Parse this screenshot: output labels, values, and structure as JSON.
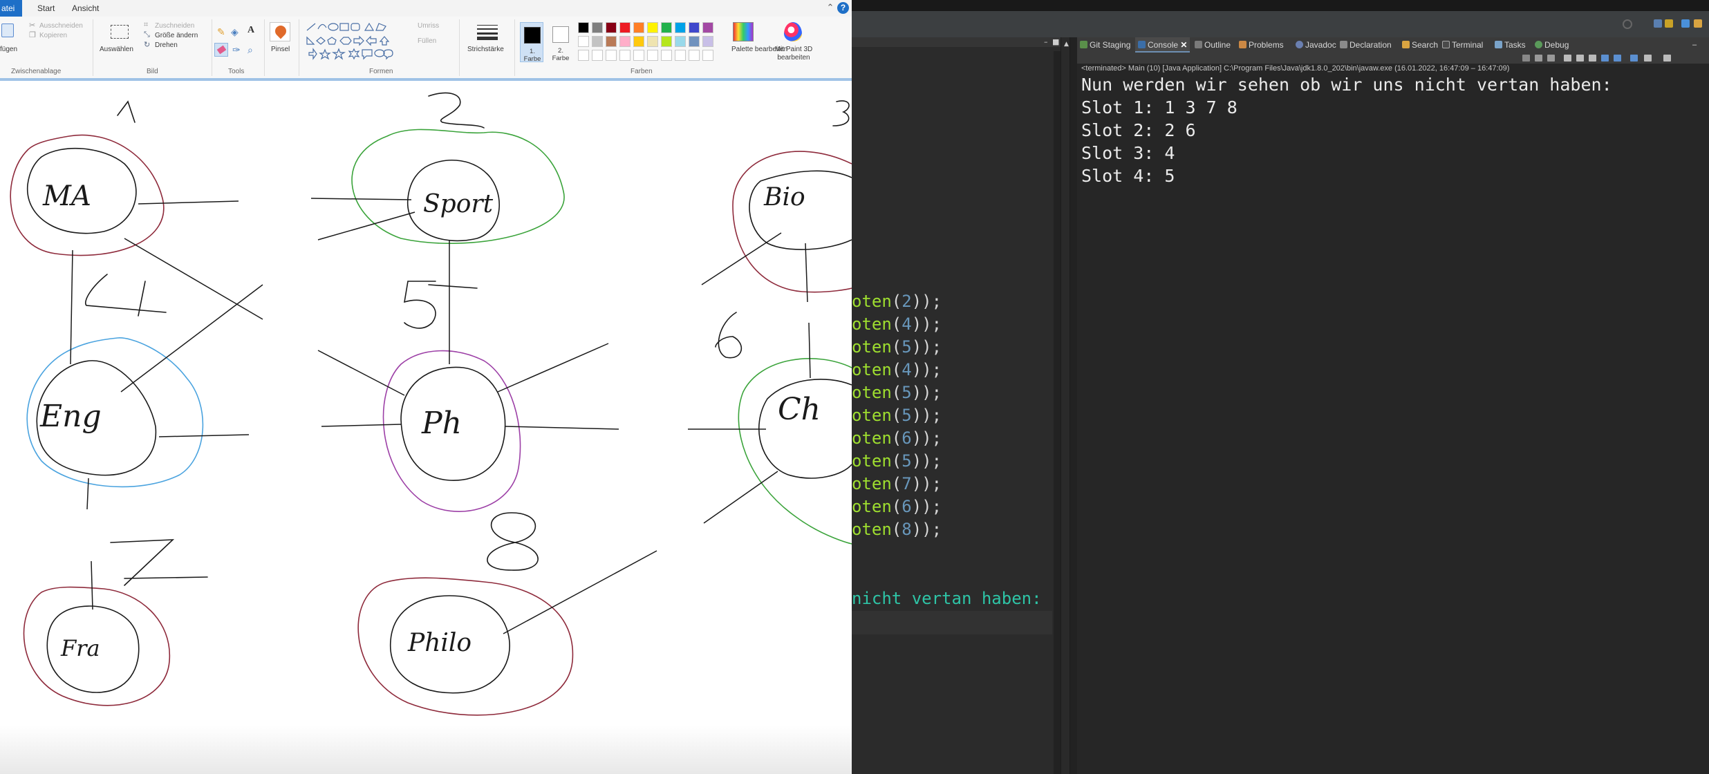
{
  "paint": {
    "tabs": [
      "atei",
      "Start",
      "Ansicht"
    ],
    "ribbon": {
      "clipboard": {
        "paste": "fügen",
        "cut": "Ausschneiden",
        "copy": "Kopieren",
        "group": "Zwischenablage"
      },
      "image": {
        "select": "Auswählen",
        "crop": "Zuschneiden",
        "resize": "Größe ändern",
        "rotate": "Drehen",
        "group": "Bild"
      },
      "tools": {
        "group": "Tools"
      },
      "brushes": {
        "label": "Pinsel"
      },
      "shapes": {
        "outline": "Umriss",
        "fill": "Füllen",
        "group": "Formen"
      },
      "size": {
        "label": "Strichstärke"
      },
      "colors": {
        "color1": "1. Farbe",
        "color2": "2. Farbe",
        "edit_palette": "Palette bearbeiten",
        "paint3d": "Mit Paint 3D bearbeiten",
        "group": "Farben",
        "palette_row1": [
          "#000000",
          "#7f7f7f",
          "#880015",
          "#ed1c24",
          "#ff7f27",
          "#fff200",
          "#22b14c",
          "#00a2e8",
          "#3f48cc",
          "#a349a4"
        ],
        "palette_row2": [
          "#ffffff",
          "#c3c3c3",
          "#b97a57",
          "#ffaec9",
          "#ffc90e",
          "#efe4b0",
          "#b5e61d",
          "#99d9ea",
          "#7092be",
          "#c8bfe7"
        ]
      }
    },
    "drawing": {
      "nodes": [
        "MA",
        "Sport",
        "Bio",
        "Eng",
        "Ph",
        "Ch",
        "Fra",
        "Philo"
      ],
      "numbers": [
        "1",
        "2",
        "3",
        "4",
        "5",
        "6",
        "7",
        "8"
      ]
    }
  },
  "eclipse": {
    "editor": {
      "lines": [
        {
          "m": "oten",
          "n": "2"
        },
        {
          "m": "oten",
          "n": "4"
        },
        {
          "m": "oten",
          "n": "5"
        },
        {
          "m": "oten",
          "n": "4"
        },
        {
          "m": "oten",
          "n": "5"
        },
        {
          "m": "oten",
          "n": "5"
        },
        {
          "m": "oten",
          "n": "6"
        },
        {
          "m": "oten",
          "n": "5"
        },
        {
          "m": "oten",
          "n": "7"
        },
        {
          "m": "oten",
          "n": "6"
        },
        {
          "m": "oten",
          "n": "8"
        }
      ],
      "tail": "nicht vertan haben:"
    },
    "console": {
      "tabs": [
        "Git Staging",
        "Console",
        "Outline",
        "Problems",
        "Javadoc",
        "Declaration",
        "Search",
        "Terminal",
        "Tasks",
        "Debug"
      ],
      "status": "<terminated> Main (10) [Java Application] C:\\Program Files\\Java\\jdk1.8.0_202\\bin\\javaw.exe  (16.01.2022, 16:47:09 – 16:47:09)",
      "output": [
        "Nun werden wir sehen ob wir uns nicht vertan haben:",
        "Slot 1: 1 3 7 8",
        "Slot 2: 2 6",
        "Slot 3: 4",
        "Slot 4: 5"
      ]
    }
  }
}
